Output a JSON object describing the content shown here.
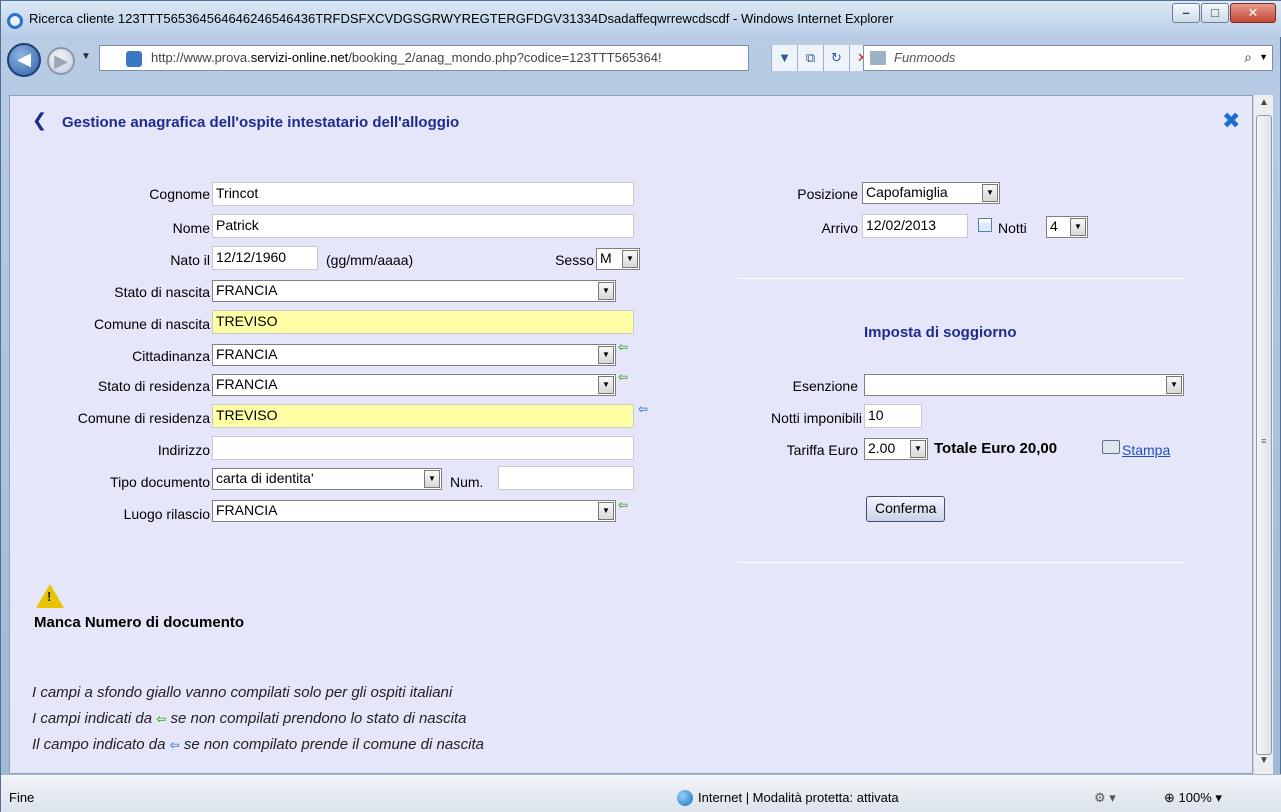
{
  "window": {
    "title": "Ricerca cliente 123TTT565364564646246546436TRFDSFXCVDGSGRWYREGTERGFDGV31334Dsadaffeqwrrewcdscdf - Windows Internet Explorer",
    "minimize_icon": "minimize-icon",
    "maximize_icon": "maximize-icon",
    "close_icon": "close-icon"
  },
  "browser": {
    "address_prefix": "http://www.prova.",
    "address_domain": "servizi-online.net",
    "address_path": "/booking_2/anag_mondo.php?codice=123TTT565364!",
    "search_placeholder": "Funmoods"
  },
  "page": {
    "title": "Gestione anagrafica dell'ospite intestatario dell'alloggio",
    "colors": {
      "title": "#1f2c8f",
      "yellow_field": "#ffffa5",
      "background": "#e6e6fa",
      "link": "#1f4fbf"
    }
  },
  "form_left": {
    "cognome": {
      "label": "Cognome",
      "value": "Trincot"
    },
    "nome": {
      "label": "Nome",
      "value": "Patrick"
    },
    "nato_il": {
      "label": "Nato il",
      "value": "12/12/1960",
      "hint": "(gg/mm/aaaa)"
    },
    "sesso": {
      "label": "Sesso",
      "value": "M"
    },
    "stato_nascita": {
      "label": "Stato di nascita",
      "value": "FRANCIA"
    },
    "comune_nascita": {
      "label": "Comune di nascita",
      "value": "TREVISO"
    },
    "cittadinanza": {
      "label": "Cittadinanza",
      "value": "FRANCIA"
    },
    "stato_residenza": {
      "label": "Stato di residenza",
      "value": "FRANCIA"
    },
    "comune_residenza": {
      "label": "Comune di residenza",
      "value": "TREVISO"
    },
    "indirizzo": {
      "label": "Indirizzo",
      "value": ""
    },
    "tipo_documento": {
      "label": "Tipo documento",
      "value": "carta di identita'"
    },
    "num": {
      "label": "Num.",
      "value": ""
    },
    "luogo_rilascio": {
      "label": "Luogo rilascio",
      "value": "FRANCIA"
    }
  },
  "form_right": {
    "posizione": {
      "label": "Posizione",
      "value": "Capofamiglia"
    },
    "arrivo": {
      "label": "Arrivo",
      "value": "12/02/2013"
    },
    "notti": {
      "label": "Notti",
      "value": "4"
    },
    "imposta_title": "Imposta di soggiorno",
    "esenzione": {
      "label": "Esenzione",
      "value": ""
    },
    "notti_imponibili": {
      "label": "Notti imponibili",
      "value": "10"
    },
    "tariffa": {
      "label": "Tariffa Euro",
      "value": "2.00"
    },
    "totale": "Totale Euro 20,00",
    "stampa": "Stampa",
    "conferma": "Conferma"
  },
  "warning": {
    "text": "Manca Numero di documento"
  },
  "notes": [
    "I campi a sfondo giallo vanno compilati solo per gli ospiti italiani",
    "I campi indicati da",
    "se non compilati prendono lo stato di nascita",
    "Il campo indicato da",
    "se non compilato prende il comune di nascita"
  ],
  "status": {
    "left": "Fine",
    "zone": "Internet | Modalità protetta: attivata",
    "zoom": "100%"
  }
}
